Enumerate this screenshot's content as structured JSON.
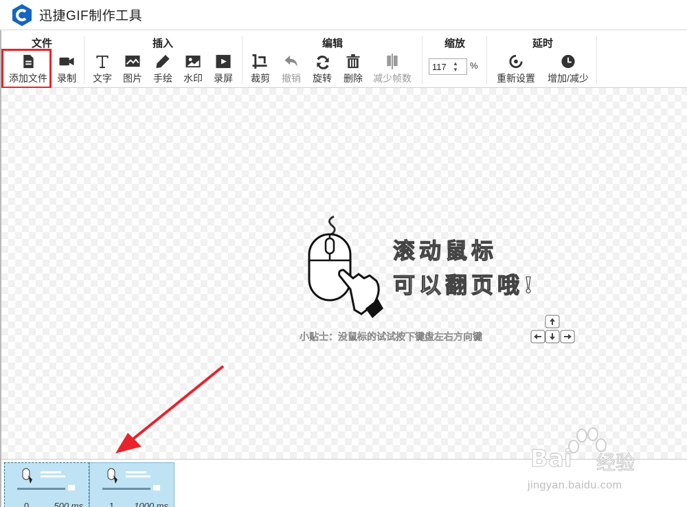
{
  "app": {
    "title": "迅捷GIF制作工具"
  },
  "ribbon": {
    "groups": [
      {
        "title": "文件",
        "tools": [
          {
            "label": "添加文件",
            "icon": "add-file-icon"
          },
          {
            "label": "录制",
            "icon": "video-camera-icon"
          }
        ]
      },
      {
        "title": "插入",
        "tools": [
          {
            "label": "文字",
            "icon": "text-icon"
          },
          {
            "label": "图片",
            "icon": "image-icon"
          },
          {
            "label": "手绘",
            "icon": "pencil-icon"
          },
          {
            "label": "水印",
            "icon": "watermark-icon"
          },
          {
            "label": "录屏",
            "icon": "screen-record-icon"
          }
        ]
      },
      {
        "title": "编辑",
        "tools": [
          {
            "label": "裁剪",
            "icon": "crop-icon"
          },
          {
            "label": "撤销",
            "icon": "undo-icon"
          },
          {
            "label": "旋转",
            "icon": "rotate-icon"
          },
          {
            "label": "删除",
            "icon": "trash-icon"
          },
          {
            "label": "减少帧数",
            "icon": "reduce-frames-icon"
          }
        ]
      },
      {
        "title": "缩放",
        "zoom_value": "117",
        "zoom_unit": "%"
      },
      {
        "title": "延时",
        "tools": [
          {
            "label": "重新设置",
            "icon": "reset-icon"
          },
          {
            "label": "增加/减少",
            "icon": "clock-icon"
          }
        ]
      }
    ]
  },
  "canvas": {
    "hint_line1": "滚动鼠标",
    "hint_line2": "可以翻页哦!",
    "tip": "小贴士：没鼠标的试试按下键盘左右方向键"
  },
  "filmstrip": {
    "frames": [
      {
        "index": "0",
        "duration": "500 ms"
      },
      {
        "index": "1",
        "duration": "1000 ms"
      }
    ]
  },
  "watermark": {
    "brand": "Bai",
    "brand2": "经验",
    "url": "jingyan.baidu.com"
  },
  "colors": {
    "highlight": "#e8232b",
    "accent": "#1565c0",
    "frame_bg": "#bfe3f4"
  }
}
